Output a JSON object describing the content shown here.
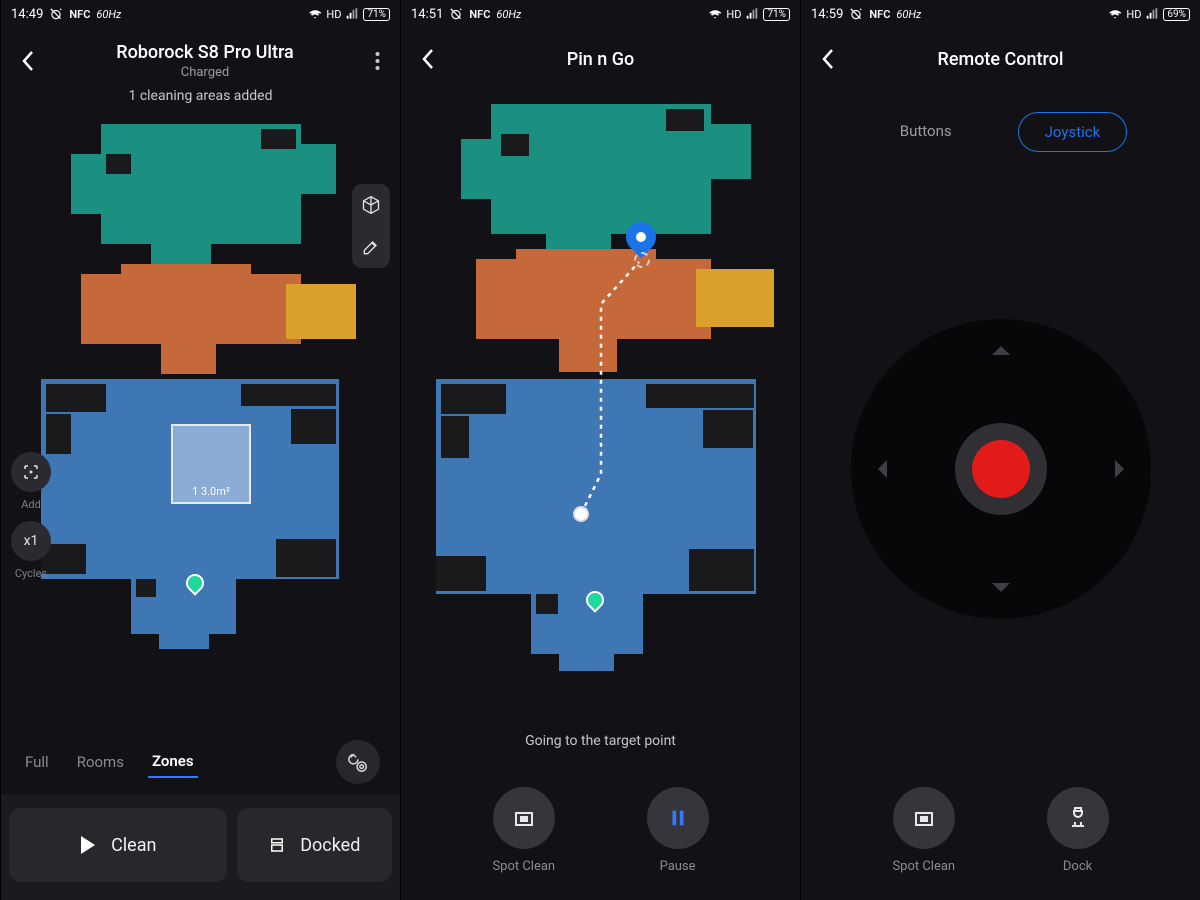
{
  "screens": [
    {
      "status": {
        "time": "14:49",
        "nfc": "NFC",
        "hz": "60Hz",
        "hd": "HD",
        "battery": "71%"
      },
      "title": "Roborock S8 Pro Ultra",
      "subtitle": "Charged",
      "subline": "1 cleaning areas added",
      "selection_label": "1  3.0m²",
      "left_tools": {
        "add": "Add",
        "cycles": "Cycles",
        "cycles_value": "x1"
      },
      "mode_tabs": {
        "full": "Full",
        "rooms": "Rooms",
        "zones": "Zones"
      },
      "actions": {
        "clean": "Clean",
        "docked": "Docked"
      }
    },
    {
      "status": {
        "time": "14:51",
        "nfc": "NFC",
        "hz": "60Hz",
        "hd": "HD",
        "battery": "71%"
      },
      "title": "Pin n Go",
      "note": "Going to the target point",
      "actions": {
        "spot": "Spot Clean",
        "pause": "Pause"
      }
    },
    {
      "status": {
        "time": "14:59",
        "nfc": "NFC",
        "hz": "60Hz",
        "hd": "HD",
        "battery": "69%"
      },
      "title": "Remote Control",
      "toggle": {
        "buttons": "Buttons",
        "joystick": "Joystick"
      },
      "actions": {
        "spot": "Spot Clean",
        "dock": "Dock"
      }
    }
  ],
  "colors": {
    "teal": "#1b8f80",
    "orange": "#c5683a",
    "mustard": "#d9a02b",
    "blue": "#3f77b5",
    "accent": "#1b73e8",
    "red": "#e21a1a"
  }
}
